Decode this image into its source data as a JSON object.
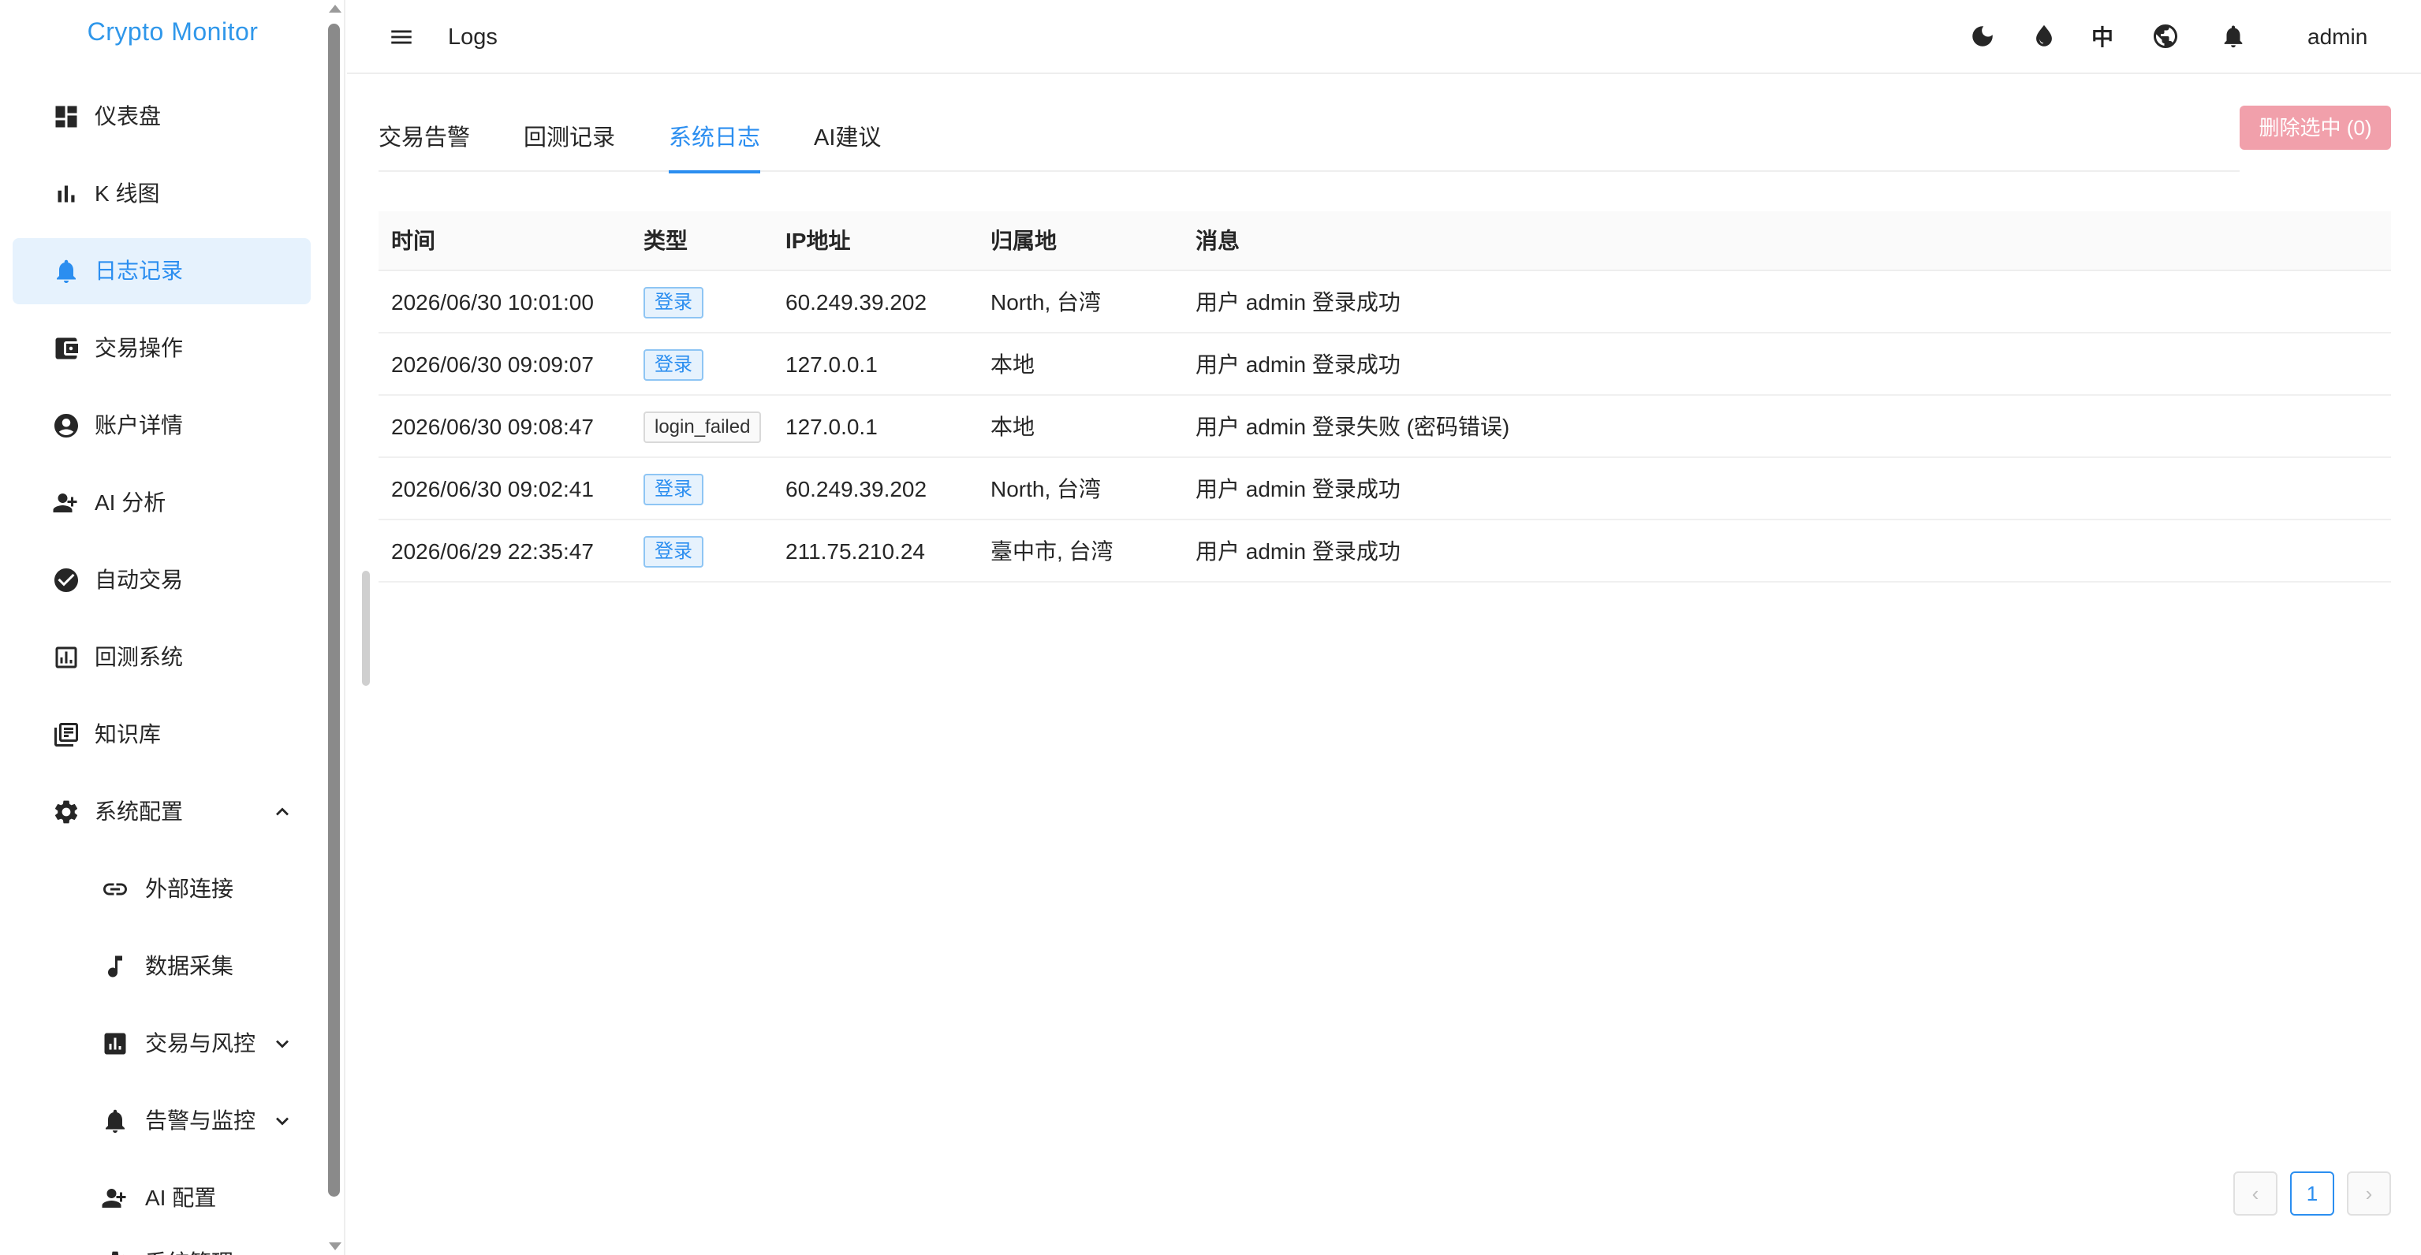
{
  "app": {
    "brand": "Crypto Monitor"
  },
  "header": {
    "title": "Logs",
    "lang_label": "中",
    "user": "admin"
  },
  "sidebar": {
    "items": [
      {
        "label": "仪表盘",
        "icon": "dashboard-icon"
      },
      {
        "label": "K 线图",
        "icon": "bar-chart-icon"
      },
      {
        "label": "日志记录",
        "icon": "bell-icon",
        "active": true
      },
      {
        "label": "交易操作",
        "icon": "wallet-icon"
      },
      {
        "label": "账户详情",
        "icon": "account-circle-icon"
      },
      {
        "label": "AI 分析",
        "icon": "person-add-icon"
      },
      {
        "label": "自动交易",
        "icon": "check-circle-icon"
      },
      {
        "label": "回测系统",
        "icon": "analytics-icon"
      },
      {
        "label": "知识库",
        "icon": "library-books-icon"
      },
      {
        "label": "系统配置",
        "icon": "gear-icon",
        "expanded": true
      },
      {
        "label": "外部连接",
        "icon": "link-icon"
      },
      {
        "label": "数据采集",
        "icon": "music-note-icon"
      },
      {
        "label": "交易与风控",
        "icon": "analytics-icon"
      },
      {
        "label": "告警与监控",
        "icon": "bell-icon"
      },
      {
        "label": "AI 配置",
        "icon": "person-add-icon"
      },
      {
        "label": "系统管理",
        "icon": "gear-icon"
      }
    ]
  },
  "tabs": [
    {
      "label": "交易告警"
    },
    {
      "label": "回测记录"
    },
    {
      "label": "系统日志",
      "active": true
    },
    {
      "label": "AI建议"
    }
  ],
  "actions": {
    "delete_selected": "删除选中 (0)"
  },
  "table": {
    "columns": [
      "时间",
      "类型",
      "IP地址",
      "归属地",
      "消息"
    ],
    "rows": [
      {
        "time": "2026/06/30 10:01:00",
        "type": "登录",
        "ip": "60.249.39.202",
        "location": "North, 台湾",
        "message": "用户 admin 登录成功"
      },
      {
        "time": "2026/06/30 09:09:07",
        "type": "登录",
        "ip": "127.0.0.1",
        "location": "本地",
        "message": "用户 admin 登录成功"
      },
      {
        "time": "2026/06/30 09:08:47",
        "type": "login_failed",
        "ip": "127.0.0.1",
        "location": "本地",
        "message": "用户 admin 登录失败 (密码错误)"
      },
      {
        "time": "2026/06/30 09:02:41",
        "type": "登录",
        "ip": "60.249.39.202",
        "location": "North, 台湾",
        "message": "用户 admin 登录成功"
      },
      {
        "time": "2026/06/29 22:35:47",
        "type": "登录",
        "ip": "211.75.210.24",
        "location": "臺中市, 台湾",
        "message": "用户 admin 登录成功"
      }
    ]
  },
  "pagination": {
    "prev": "‹",
    "current": "1",
    "next": "›"
  },
  "colors": {
    "accent": "#2b8ef0",
    "brand": "#2f97ea",
    "danger_disabled": "#f1a0ab"
  }
}
